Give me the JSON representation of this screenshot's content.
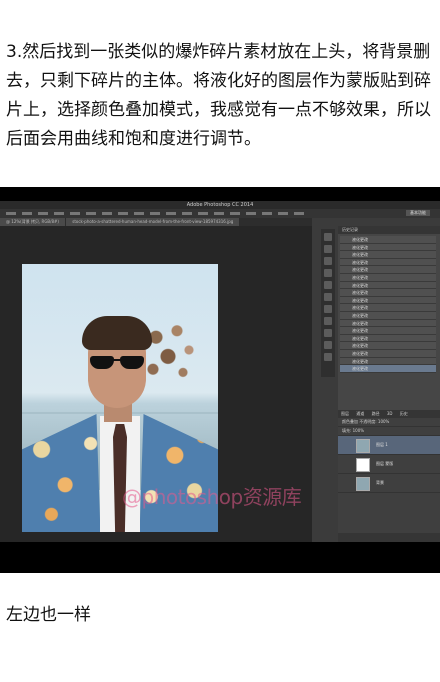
{
  "article": {
    "paragraph": "3.然后找到一张类似的爆炸碎片素材放在上头，将背景删去，只剩下碎片的主体。将液化好的图层作为蒙版贴到碎片上，选择颜色叠加模式，我感觉有一点不够效果，所以后面会用曲线和饱和度进行调节。",
    "caption": "左边也一样"
  },
  "screenshot": {
    "title": "Adobe Photoshop CC 2014",
    "workspace_button": "基本功能",
    "doc_tab": "@ 12%(背景 拷贝, RGB/8#)",
    "doc_tab2": "stock-photo-a-shattered-human-head-model-from-the-front-view-185974316.jpg",
    "watermark": "@photoshop资源库",
    "history_panel_title": "历史记录",
    "history_items": [
      "液化更改",
      "液化更改",
      "液化更改",
      "液化更改",
      "液化更改",
      "液化更改",
      "液化更改",
      "液化更改",
      "液化更改",
      "液化更改",
      "液化更改",
      "液化更改",
      "液化更改",
      "液化更改",
      "液化更改",
      "液化更改",
      "液化更改",
      "液化更改"
    ],
    "layers_tabs": [
      "图层",
      "通道",
      "路径",
      "3D",
      "历史"
    ],
    "layer_mode": "颜色叠加",
    "opacity_label": "不透明度:",
    "opacity_value": "100%",
    "fill_label": "填充:",
    "fill_value": "100%",
    "layers": [
      {
        "name": "图层 1"
      },
      {
        "name": "图层 蒙版"
      },
      {
        "name": "背景"
      }
    ]
  }
}
